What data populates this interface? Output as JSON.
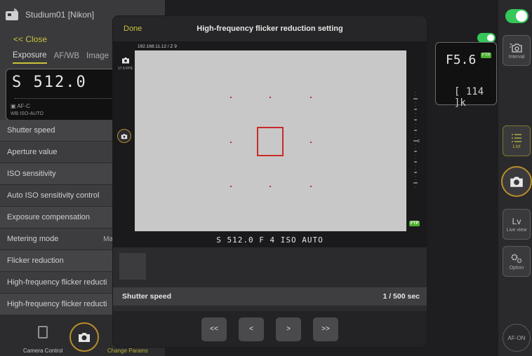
{
  "camera": {
    "name": "Studium01 [Nikon]"
  },
  "left_panel": {
    "close_label": "<< Close",
    "tabs": [
      {
        "label": "Exposure",
        "active": true
      },
      {
        "label": "AF/WB",
        "active": false
      },
      {
        "label": "Image",
        "active": false
      }
    ],
    "lcd": {
      "shutter_display": "S 512.0",
      "af_mode": "AF-C",
      "iso_label": "ISO-AUTO",
      "wb_label": "WB"
    },
    "params": [
      {
        "label": "Shutter speed",
        "value": ""
      },
      {
        "label": "Aperture value",
        "value": ""
      },
      {
        "label": "ISO sensitivity",
        "value": ""
      },
      {
        "label": "Auto ISO sensitivity control",
        "value": ""
      },
      {
        "label": "Exposure compensation",
        "value": ""
      },
      {
        "label": "Metering mode",
        "value": "Ma"
      },
      {
        "label": "Flicker reduction",
        "value": ""
      },
      {
        "label": "High-frequency flicker reducti",
        "value": ""
      },
      {
        "label": "High-frequency flicker reducti",
        "value": ""
      }
    ],
    "bottom": {
      "camera_control_label": "Camera Control",
      "change_params_label": "Change Params"
    }
  },
  "right_lcd": {
    "aperture": "F5.6",
    "ftp_badge": "FTP",
    "shots_remaining": "[ 114 ]k"
  },
  "sidebar": {
    "interval_label": "Interval",
    "list_label": "List",
    "liveview_title": "Lv",
    "liveview_label": "Live view",
    "option_label": "Option",
    "afon_label": "AF-ON"
  },
  "modal": {
    "done_label": "Done",
    "title": "High-frequency flicker reduction setting",
    "live_view": {
      "ip_text": "192.168.11.12 / Z 9",
      "fps_text": "17.5 FPS",
      "ftp_badge": "FTP",
      "status_text": "S 512.0 F 4 ISO AUTO"
    },
    "shutter_row": {
      "label": "Shutter speed",
      "value": "1 / 500 sec"
    },
    "nav": {
      "first": "<<",
      "prev": "<",
      "next": ">",
      "last": ">>"
    }
  },
  "colors": {
    "accent": "#c8c23a",
    "toggle_on": "#35c759",
    "af_box": "#c82a2a",
    "ftp": "#4caf2f"
  }
}
